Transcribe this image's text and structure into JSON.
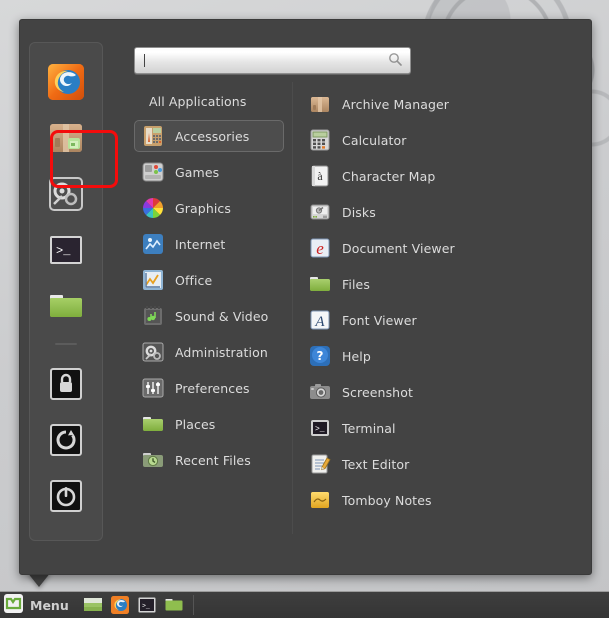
{
  "desktop": {
    "wallpaper_description": "light gray blurred circles"
  },
  "menu": {
    "search": {
      "value": "",
      "placeholder": "",
      "icon": "search-icon"
    },
    "favorites": [
      {
        "name": "firefox",
        "icon": "firefox-icon",
        "highlighted": false
      },
      {
        "name": "software-manager",
        "icon": "software-manager-icon",
        "highlighted": true
      },
      {
        "name": "system-settings",
        "icon": "system-settings-icon",
        "highlighted": false
      },
      {
        "name": "terminal",
        "icon": "terminal-icon",
        "highlighted": false
      },
      {
        "name": "files",
        "icon": "folder-icon",
        "highlighted": false
      }
    ],
    "session": [
      {
        "name": "lock-screen",
        "icon": "lock-icon"
      },
      {
        "name": "log-out",
        "icon": "logout-icon"
      },
      {
        "name": "quit",
        "icon": "power-icon"
      }
    ],
    "categories": [
      {
        "label": "All Applications",
        "icon": "",
        "selected": false,
        "is_header": true
      },
      {
        "label": "Accessories",
        "icon": "accessories-icon",
        "selected": true,
        "is_header": false
      },
      {
        "label": "Games",
        "icon": "games-icon",
        "selected": false,
        "is_header": false
      },
      {
        "label": "Graphics",
        "icon": "graphics-icon",
        "selected": false,
        "is_header": false
      },
      {
        "label": "Internet",
        "icon": "internet-icon",
        "selected": false,
        "is_header": false
      },
      {
        "label": "Office",
        "icon": "office-icon",
        "selected": false,
        "is_header": false
      },
      {
        "label": "Sound & Video",
        "icon": "sound-video-icon",
        "selected": false,
        "is_header": false
      },
      {
        "label": "Administration",
        "icon": "administration-icon",
        "selected": false,
        "is_header": false
      },
      {
        "label": "Preferences",
        "icon": "preferences-icon",
        "selected": false,
        "is_header": false
      },
      {
        "label": "Places",
        "icon": "places-icon",
        "selected": false,
        "is_header": false
      },
      {
        "label": "Recent Files",
        "icon": "recent-files-icon",
        "selected": false,
        "is_header": false
      }
    ],
    "applications": [
      {
        "label": "Archive Manager",
        "icon": "archive-manager-icon"
      },
      {
        "label": "Calculator",
        "icon": "calculator-icon"
      },
      {
        "label": "Character Map",
        "icon": "character-map-icon"
      },
      {
        "label": "Disks",
        "icon": "disks-icon"
      },
      {
        "label": "Document Viewer",
        "icon": "document-viewer-icon"
      },
      {
        "label": "Files",
        "icon": "files-icon"
      },
      {
        "label": "Font Viewer",
        "icon": "font-viewer-icon"
      },
      {
        "label": "Help",
        "icon": "help-icon"
      },
      {
        "label": "Screenshot",
        "icon": "screenshot-icon"
      },
      {
        "label": "Terminal",
        "icon": "terminal-app-icon"
      },
      {
        "label": "Text Editor",
        "icon": "text-editor-icon"
      },
      {
        "label": "Tomboy Notes",
        "icon": "tomboy-notes-icon"
      }
    ],
    "scrollbar": {
      "position": "right",
      "thumb_fraction": 0.82
    },
    "highlight_box_color": "#f40c0c"
  },
  "panel": {
    "menu_button": {
      "label": "Menu",
      "icon": "linux-mint-logo-icon"
    },
    "quicklaunch": [
      {
        "name": "show-desktop",
        "icon": "show-desktop-icon"
      },
      {
        "name": "firefox",
        "icon": "firefox-icon"
      },
      {
        "name": "terminal",
        "icon": "terminal-icon"
      },
      {
        "name": "files",
        "icon": "folder-icon"
      }
    ]
  },
  "colors": {
    "menu_bg": "#434343",
    "sidebar_bg": "#4a4a4a",
    "text": "#dcdcdc",
    "accent_red": "#f40c0c"
  }
}
